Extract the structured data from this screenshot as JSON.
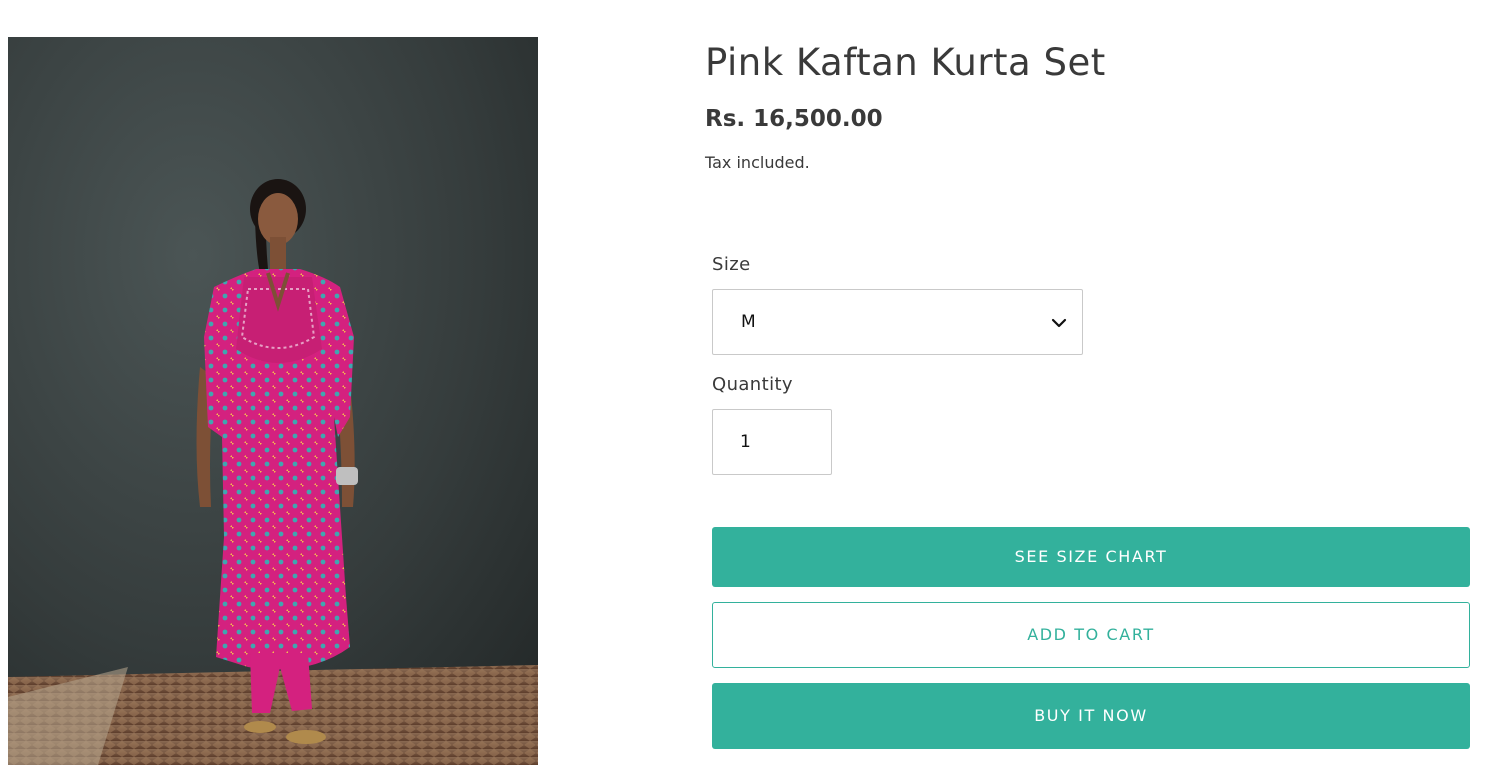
{
  "product": {
    "title": "Pink Kaftan Kurta Set",
    "price": "Rs. 16,500.00",
    "tax_note": "Tax included.",
    "image_alt": "Model wearing pink kaftan kurta set"
  },
  "form": {
    "size_label": "Size",
    "size_selected": "M",
    "quantity_label": "Quantity",
    "quantity_value": "1"
  },
  "buttons": {
    "size_chart": "SEE SIZE CHART",
    "add_to_cart": "ADD TO CART",
    "buy_now": "BUY IT NOW"
  },
  "colors": {
    "accent": "#33b19c",
    "text": "#3a3a3a",
    "kurta_pink": "#d4217f"
  },
  "icons": {
    "select_indicator": "chevron-down-icon"
  }
}
